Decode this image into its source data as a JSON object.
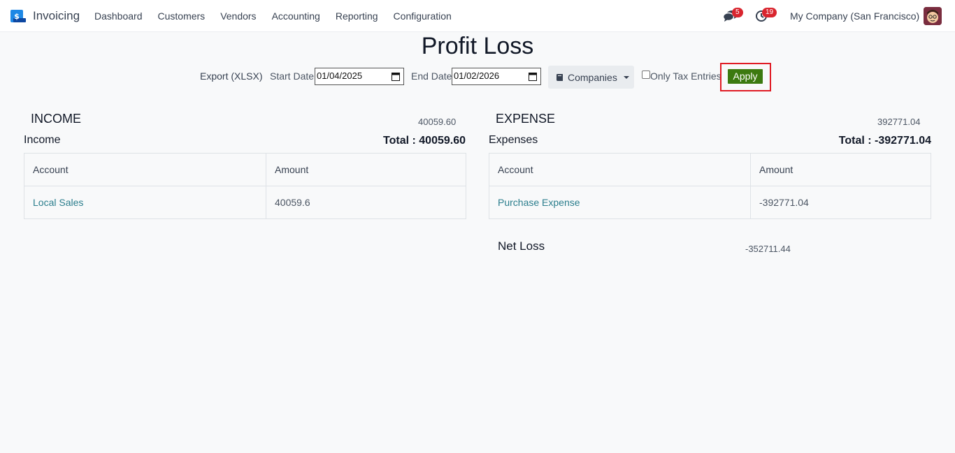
{
  "app": {
    "name": "Invoicing"
  },
  "menu": [
    "Dashboard",
    "Customers",
    "Vendors",
    "Accounting",
    "Reporting",
    "Configuration"
  ],
  "navbar": {
    "messages_count": "5",
    "activities_count": "19",
    "company": "My Company (San Francisco)"
  },
  "page": {
    "title": "Profit Loss"
  },
  "filters": {
    "export_label": "Export (XLSX)",
    "start_date_label": "Start Date",
    "start_date": "01/04/2025",
    "end_date_label": "End Date",
    "end_date": "01/02/2026",
    "companies_label": "Companies",
    "only_tax_label": "Only Tax Entries",
    "apply_label": "Apply"
  },
  "income": {
    "heading": "INCOME",
    "amount": "40059.60",
    "group": "Income",
    "total": "Total : 40059.60",
    "col_account": "Account",
    "col_amount": "Amount",
    "rows": [
      {
        "account": "Local Sales",
        "amount": "40059.6"
      }
    ]
  },
  "expense": {
    "heading": "EXPENSE",
    "amount": "392771.04",
    "group": "Expenses",
    "total": "Total : -392771.04",
    "col_account": "Account",
    "col_amount": "Amount",
    "rows": [
      {
        "account": "Purchase Expense",
        "amount": "-392771.04"
      }
    ]
  },
  "net": {
    "label": "Net Loss",
    "value": "-352711.44"
  },
  "colors": {
    "apply": "#3c7a10",
    "link": "#2a7d8c",
    "highlight": "#e01b24",
    "badge": "#d9252e"
  }
}
